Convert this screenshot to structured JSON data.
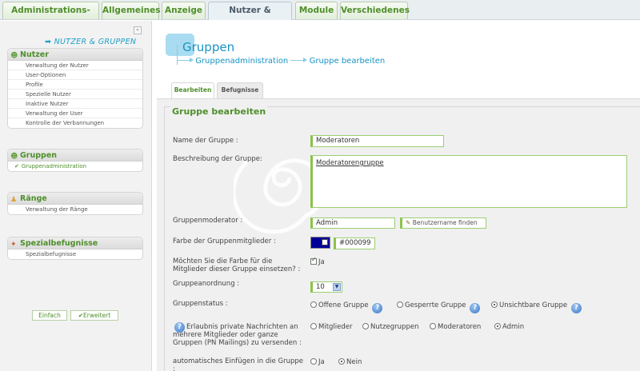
{
  "top_tabs": [
    {
      "label": "Administrations-Index"
    },
    {
      "label": "Allgemeines"
    },
    {
      "label": "Anzeige"
    },
    {
      "label": "Nutzer & Gruppen"
    },
    {
      "label": "Module"
    },
    {
      "label": "Verschiedenes"
    }
  ],
  "sidebar": {
    "collapse_icon": "«",
    "section_title": "➡ NUTZER & GRUPPEN",
    "panels": [
      {
        "title": "Nutzer",
        "icon": "user-icon",
        "items": [
          "Verwaltung der Nutzer",
          "User-Optionen",
          "Profile",
          "Spezielle Nutzer",
          "Inaktive Nutzer",
          "Verwaltung der User",
          "Kontrolle der Verbannungen"
        ]
      },
      {
        "title": "Gruppen",
        "icon": "group-icon",
        "items": [
          "Gruppenadministration"
        ]
      },
      {
        "title": "Ränge",
        "icon": "rank-icon",
        "items": [
          "Verwaltung der Ränge"
        ]
      },
      {
        "title": "Spezialbefugnisse",
        "icon": "special-icon",
        "items": [
          "Spezialbefugnisse"
        ]
      }
    ],
    "btn_simple": "Einfach",
    "btn_extended": "Erweitert"
  },
  "main": {
    "title": "Gruppen",
    "breadcrumb": [
      "Gruppenadministration",
      "Gruppe bearbeiten"
    ],
    "subtabs": [
      "Bearbeiten",
      "Befugnisse"
    ],
    "legend": "Gruppe bearbeiten",
    "form": {
      "name_label": "Name der Gruppe :",
      "name_value": "Moderatoren",
      "desc_label": "Beschreibung der Gruppe:",
      "desc_value": "Moderatorengruppe",
      "mod_label": "Gruppenmoderator :",
      "mod_value": "Admin",
      "find_user": "Benutzername finden",
      "color_label": "Farbe der Gruppenmitglieder :",
      "color_value": "#000099",
      "use_color_label": "Möchten Sie die Farbe für die Mitglieder dieser Gruppe einsetzen? :",
      "use_color_yes": "Ja",
      "order_label": "Gruppeanordnung :",
      "order_value": "10",
      "status_label": "Gruppenstatus :",
      "status_options": [
        "Offene Gruppe",
        "Gesperrte Gruppe",
        "Unsichtbare Gruppe"
      ],
      "pm_label": "Erlaubnis private Nachrichten an mehrere Mitglieder oder ganze Gruppen (PN Mailings) zu versenden :",
      "pm_options": [
        "Mitglieder",
        "Nutzegruppen",
        "Moderatoren",
        "Admin"
      ],
      "auto_label": "automatisches Einfügen in die Gruppe :",
      "auto_options": [
        "Ja",
        "Nein"
      ]
    }
  },
  "colors": {
    "accent_green": "#4f8f2b",
    "accent_blue": "#1993c4",
    "swatch": "#000099"
  }
}
